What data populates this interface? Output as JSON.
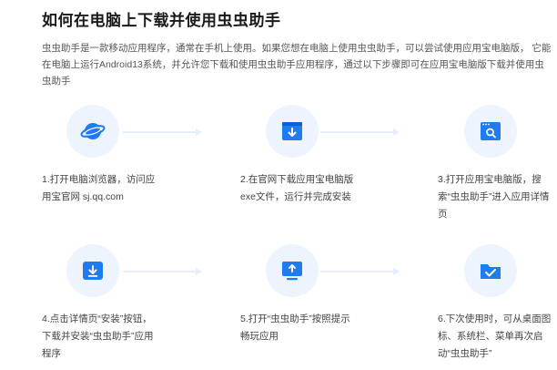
{
  "title": "如何在电脑上下载并使用虫虫助手",
  "intro": "虫虫助手是一款移动应用程序，通常在手机上使用。如果您想在电脑上使用虫虫助手，可以尝试使用应用宝电脑版， 它能在电脑上运行Android13系统，并允许您下载和使用虫虫助手应用程序，通过以下步骤即可在应用宝电脑版下载并使用虫虫助手",
  "accent_color": "#1e7bf2",
  "steps": [
    {
      "icon": "globe-icon",
      "text": "1.打开电脑浏览器，访问应用宝官网 sj.qq.com"
    },
    {
      "icon": "download-window-icon",
      "text": "2.在官网下载应用宝电脑版exe文件，运行并完成安装"
    },
    {
      "icon": "search-window-icon",
      "text": "3.打开应用宝电脑版，搜索“虫虫助手”进入应用详情页"
    },
    {
      "icon": "download-box-icon",
      "text": "4.点击详情页“安装”按钮，下载并安装“虫虫助手”应用程序"
    },
    {
      "icon": "launch-monitor-icon",
      "text": "5.打开“虫虫助手”按照提示畅玩应用"
    },
    {
      "icon": "folder-check-icon",
      "text": "6.下次使用时，可从桌面图标、系统栏、菜单再次启动“虫虫助手”"
    }
  ]
}
